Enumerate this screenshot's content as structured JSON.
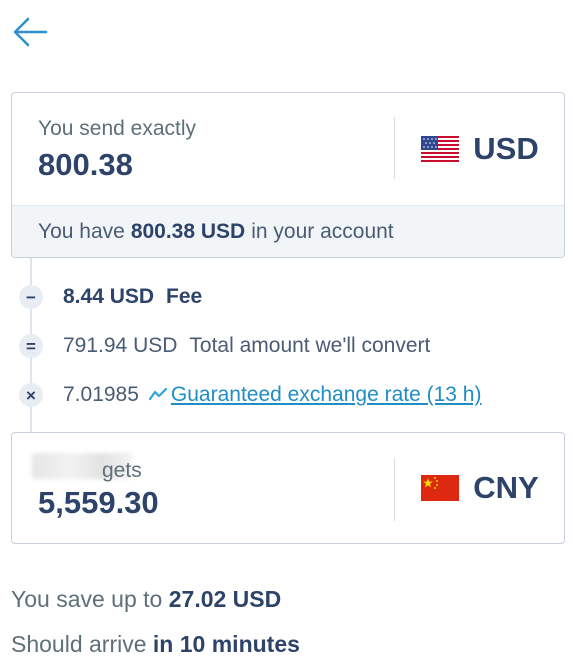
{
  "back": {
    "icon": "arrow-left-icon"
  },
  "send": {
    "label": "You send exactly",
    "amount": "800.38",
    "currency": "USD",
    "flag": "us-flag-icon",
    "balance_prefix": "You have",
    "balance_amount": "800.38 USD",
    "balance_suffix": "in your account"
  },
  "breakdown": {
    "fee": {
      "operator": "−",
      "amount": "8.44 USD",
      "label": "Fee"
    },
    "convert": {
      "operator": "=",
      "amount": "791.94 USD",
      "label": "Total amount we'll convert"
    },
    "rate": {
      "operator": "×",
      "value": "7.01985",
      "icon": "rate-trend-icon",
      "link": "Guaranteed exchange rate (13 h)"
    }
  },
  "receive": {
    "label": "gets",
    "amount": "5,559.30",
    "currency": "CNY",
    "flag": "cn-flag-icon"
  },
  "summary": {
    "save_prefix": "You save up to",
    "save_amount": "27.02 USD",
    "arrive_prefix": "Should arrive",
    "arrive_value": "in 10 minutes"
  },
  "colors": {
    "brand_dark": "#2e4369",
    "link": "#1f8dc7",
    "accent": "#2ea5d8"
  }
}
